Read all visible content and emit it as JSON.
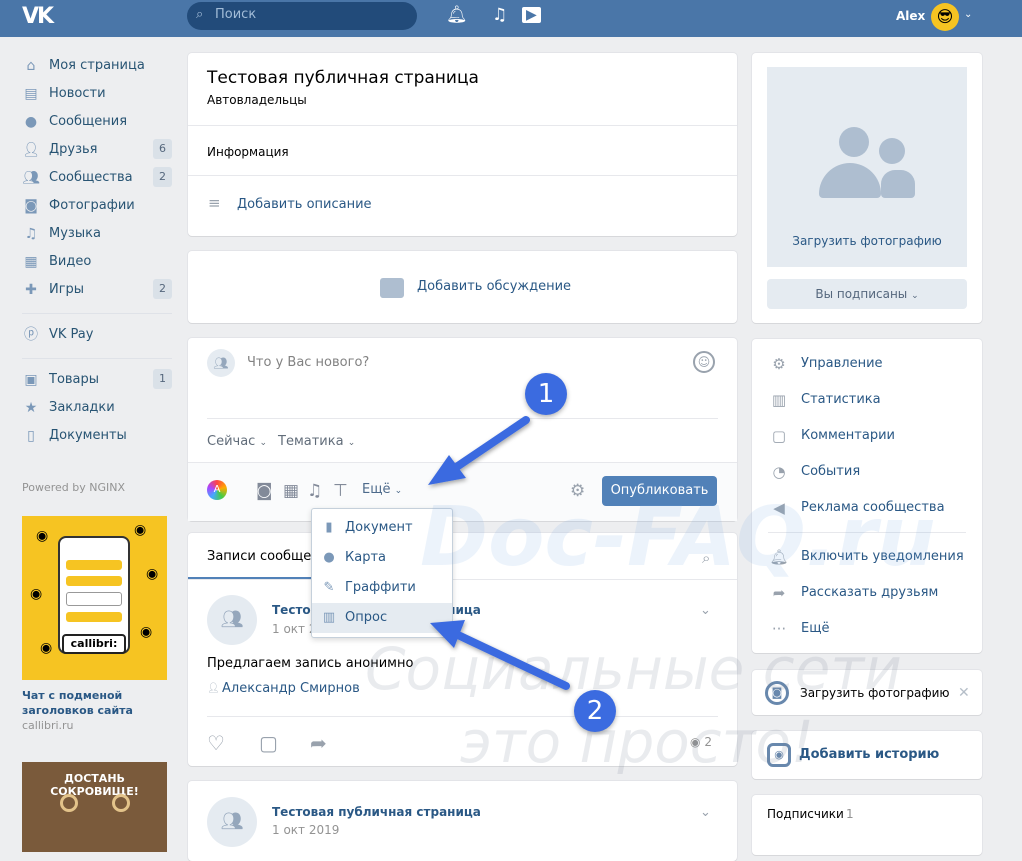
{
  "topbar": {
    "logo": "VK",
    "search_placeholder": "Поиск",
    "user_name": "Alex"
  },
  "sidebar": {
    "items": [
      {
        "label": "Моя страница",
        "icon": "home-icon"
      },
      {
        "label": "Новости",
        "icon": "news-icon"
      },
      {
        "label": "Сообщения",
        "icon": "messages-icon"
      },
      {
        "label": "Друзья",
        "icon": "friends-icon",
        "count": "6"
      },
      {
        "label": "Сообщества",
        "icon": "communities-icon",
        "count": "2"
      },
      {
        "label": "Фотографии",
        "icon": "camera-icon"
      },
      {
        "label": "Музыка",
        "icon": "music-icon"
      },
      {
        "label": "Видео",
        "icon": "video-icon"
      },
      {
        "label": "Игры",
        "icon": "gamepad-icon",
        "count": "2"
      }
    ],
    "items2": [
      {
        "label": "VK Pay",
        "icon": "vkpay-icon"
      }
    ],
    "items3": [
      {
        "label": "Товары",
        "icon": "bag-icon",
        "count": "1"
      },
      {
        "label": "Закладки",
        "icon": "star-icon"
      },
      {
        "label": "Документы",
        "icon": "document-icon"
      }
    ],
    "powered": "Powered by NGINX"
  },
  "ad": {
    "brand": "callibri:",
    "title": "Чат с подменой заголовков сайта",
    "site": "callibri.ru",
    "ad2_title": "ДОСТАНЬ СОКРОВИЩЕ!"
  },
  "group": {
    "title": "Тестовая публичная страница",
    "subtitle": "Автовладельцы",
    "info_label": "Информация",
    "add_description": "Добавить описание",
    "add_discussion": "Добавить обсуждение"
  },
  "new_post": {
    "placeholder": "Что у Вас нового?",
    "now_label": "Сейчас",
    "topic_label": "Тематика",
    "more_label": "Ещё",
    "publish": "Опубликовать"
  },
  "attach_menu": {
    "items": [
      {
        "label": "Документ",
        "icon": "document-icon"
      },
      {
        "label": "Карта",
        "icon": "map-pin-icon"
      },
      {
        "label": "Граффити",
        "icon": "brush-icon"
      },
      {
        "label": "Опрос",
        "icon": "poll-icon"
      }
    ]
  },
  "wall": {
    "tab_label": "Записи сообщества",
    "posts": [
      {
        "name": "Тестовая публичная страница",
        "date": "1 окт 2019",
        "text": "Предлагаем запись анонимно",
        "author": "Александр Смирнов",
        "views": "2"
      },
      {
        "name": "Тестовая публичная страница",
        "date": "1 окт 2019"
      }
    ]
  },
  "right": {
    "upload_photo": "Загрузить фотографию",
    "subscribed": "Вы подписаны",
    "menu": [
      {
        "label": "Управление",
        "icon": "gear-icon"
      },
      {
        "label": "Статистика",
        "icon": "stats-icon"
      },
      {
        "label": "Комментарии",
        "icon": "comment-icon"
      },
      {
        "label": "События",
        "icon": "events-icon"
      },
      {
        "label": "Реклама сообщества",
        "icon": "megaphone-icon"
      },
      {
        "label": "Включить уведомления",
        "icon": "bell-icon"
      },
      {
        "label": "Рассказать друзьям",
        "icon": "share-icon"
      },
      {
        "label": "Ещё",
        "icon": "more-icon"
      }
    ],
    "upload_card": "Загрузить фотографию",
    "add_story": "Добавить историю",
    "subscribers_label": "Подписчики",
    "subscribers_count": "1"
  },
  "annotations": {
    "badge1": "1",
    "badge2": "2",
    "watermark1": "Doc-FAQ.ru",
    "watermark2": "Социальные сети",
    "watermark3": "это просто!"
  },
  "colors": {
    "header": "#4a76a8",
    "link": "#2a5885",
    "button": "#5181b8",
    "arrow": "#3b6be0"
  }
}
